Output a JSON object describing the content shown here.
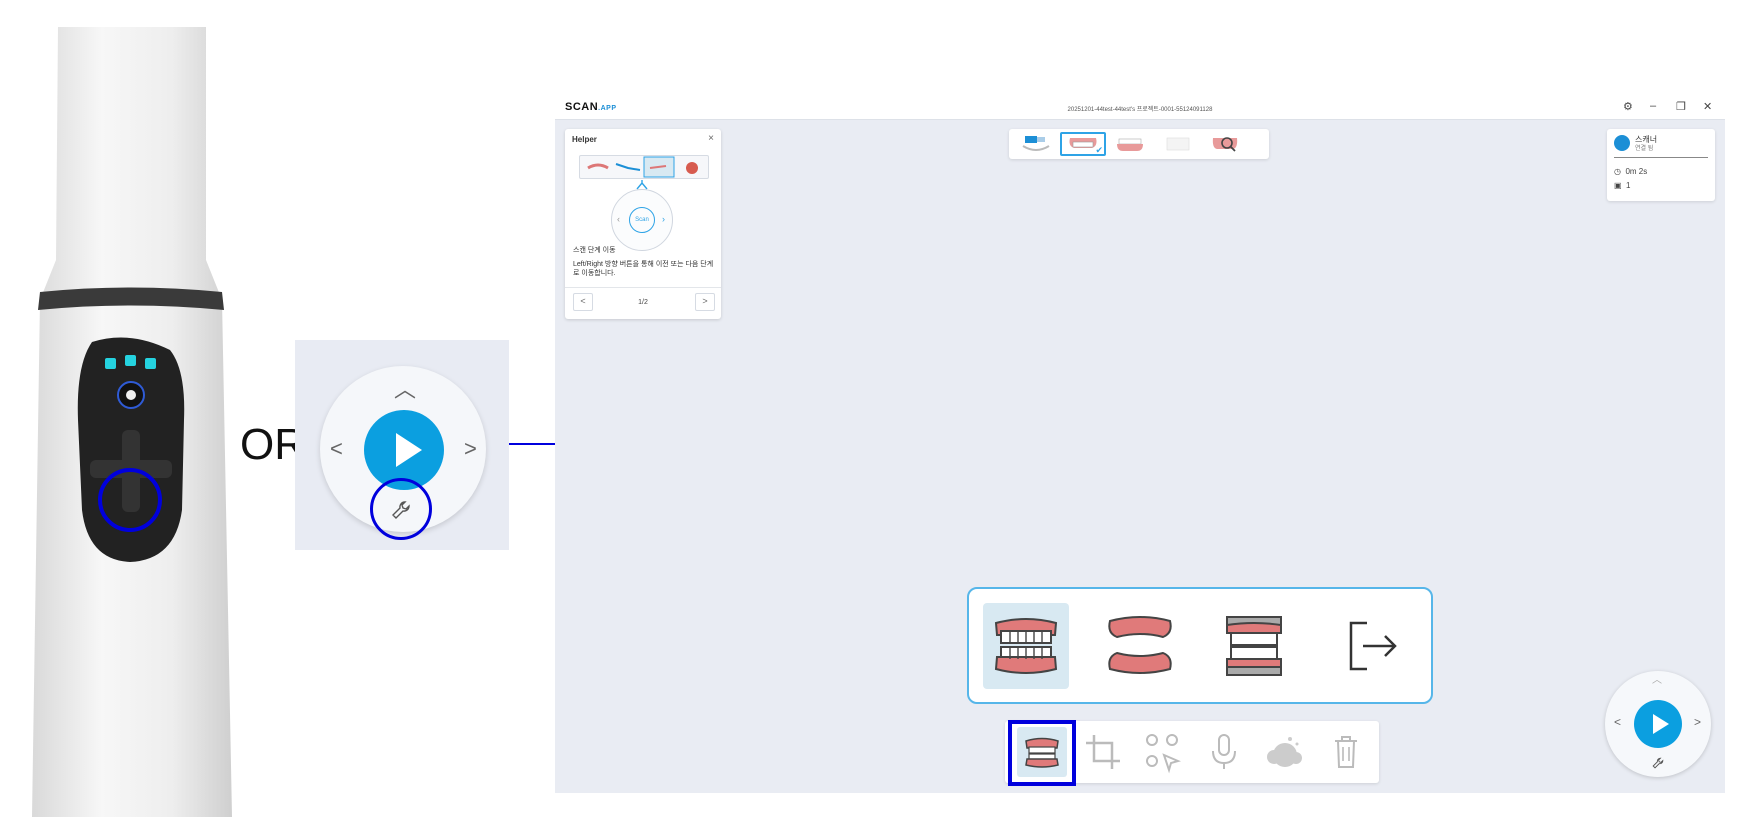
{
  "or_label": "OR",
  "zoom_control": {
    "prev_glyph": "<",
    "next_glyph": ">",
    "up_glyph": "^"
  },
  "window": {
    "logo": "SCAN",
    "logo_suffix": ".APP",
    "title": "20251201-44test-44test's 프로젝트-0001-55124091128"
  },
  "stages": [
    {
      "name": "scan-setup",
      "selected": false
    },
    {
      "name": "upper-jaw",
      "selected": true
    },
    {
      "name": "lower-jaw",
      "selected": false
    },
    {
      "name": "bite",
      "selected": false
    },
    {
      "name": "inspect",
      "selected": false
    }
  ],
  "helper": {
    "title": "Helper",
    "close": "×",
    "dial_label": "Scan",
    "heading": "스캔 단계 이동",
    "body": "Left/Right 방향 버튼을 통해 이전 또는 다음 단계로 이동합니다.",
    "page": "1/2",
    "prev": "<",
    "next": ">"
  },
  "status": {
    "name": "스캐너",
    "sub": "연결 됨",
    "time": "0m 2s",
    "count": "1"
  },
  "scan_types": [
    {
      "name": "full-arch-scan",
      "selected": true
    },
    {
      "name": "edentulous-scan",
      "selected": false
    },
    {
      "name": "bite-scan",
      "selected": false
    },
    {
      "name": "exit",
      "selected": false
    }
  ],
  "tools": [
    {
      "name": "scan-type-tool",
      "enabled": true
    },
    {
      "name": "crop-tool",
      "enabled": false
    },
    {
      "name": "select-tool",
      "enabled": false
    },
    {
      "name": "voice-tool",
      "enabled": false
    },
    {
      "name": "bubble-tool",
      "enabled": false
    },
    {
      "name": "delete-tool",
      "enabled": false
    }
  ],
  "colors": {
    "accent": "#0b9fe0",
    "highlight": "#0000dd",
    "panel_border": "#56b6e9",
    "gum": "#e07a7a"
  }
}
